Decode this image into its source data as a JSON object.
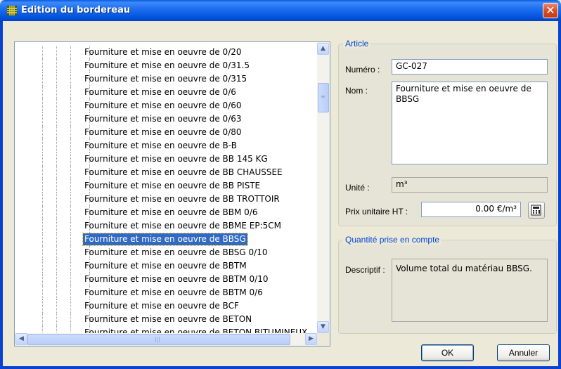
{
  "window": {
    "title": "Edition du bordereau",
    "icon": "grid-icon",
    "close_icon": "close-icon"
  },
  "tree": {
    "items": [
      "Fourniture et mise en oeuvre de 0/20",
      "Fourniture et mise en oeuvre de 0/31.5",
      "Fourniture et mise en oeuvre de 0/315",
      "Fourniture et mise en oeuvre de 0/6",
      "Fourniture et mise en oeuvre de 0/60",
      "Fourniture et mise en oeuvre de 0/63",
      "Fourniture et mise en oeuvre de 0/80",
      "Fourniture et mise en oeuvre de B-B",
      "Fourniture et mise en oeuvre de BB 145 KG",
      "Fourniture et mise en oeuvre de BB CHAUSSEE",
      "Fourniture et mise en oeuvre de BB PISTE",
      "Fourniture et mise en oeuvre de BB TROTTOIR",
      "Fourniture et mise en oeuvre de BBM 0/6",
      "Fourniture et mise en oeuvre de BBME EP:5CM",
      "Fourniture et mise en oeuvre de BBSG",
      "Fourniture et mise en oeuvre de BBSG 0/10",
      "Fourniture et mise en oeuvre de BBTM",
      "Fourniture et mise en oeuvre de BBTM 0/10",
      "Fourniture et mise en oeuvre de BBTM 0/6",
      "Fourniture et mise en oeuvre de BCF",
      "Fourniture et mise en oeuvre de BETON",
      "Fourniture et mise en oeuvre de BETON BITUMINEUX"
    ],
    "selected_index": 14,
    "scroll_vertical": 0.24,
    "scroll_horizontal": 0.0
  },
  "article": {
    "legend": "Article",
    "numero_label": "Numéro :",
    "numero_value": "GC-027",
    "nom_label": "Nom :",
    "nom_value": "Fourniture et mise en oeuvre de BBSG",
    "unite_label": "Unité :",
    "unite_value": "m³",
    "prix_label": "Prix unitaire HT :",
    "prix_value": "0.00 €/m³",
    "calc_icon": "calculator-icon"
  },
  "quantite": {
    "legend": "Quantité prise en compte",
    "descriptif_label": "Descriptif :",
    "descriptif_value": "Volume total du matériau BBSG."
  },
  "buttons": {
    "ok_label": "OK",
    "cancel_label": "Annuler"
  }
}
